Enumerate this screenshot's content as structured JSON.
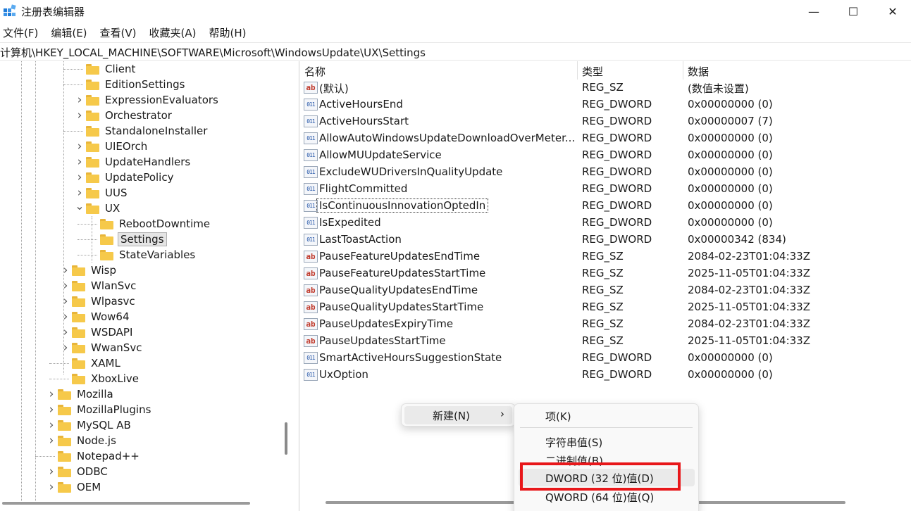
{
  "window": {
    "title": "注册表编辑器",
    "controls": {
      "minimize": "—",
      "maximize": "☐",
      "close": "✕"
    }
  },
  "menubar": [
    "文件(F)",
    "编辑(E)",
    "查看(V)",
    "收藏夹(A)",
    "帮助(H)"
  ],
  "address": "计算机\\HKEY_LOCAL_MACHINE\\SOFTWARE\\Microsoft\\WindowsUpdate\\UX\\Settings",
  "tree": [
    {
      "label": "Client",
      "expandable": false,
      "level": 2
    },
    {
      "label": "EditionSettings",
      "expandable": false,
      "level": 2
    },
    {
      "label": "ExpressionEvaluators",
      "expandable": true,
      "level": 2
    },
    {
      "label": "Orchestrator",
      "expandable": true,
      "level": 2
    },
    {
      "label": "StandaloneInstaller",
      "expandable": false,
      "level": 2
    },
    {
      "label": "UIEOrch",
      "expandable": true,
      "level": 2
    },
    {
      "label": "UpdateHandlers",
      "expandable": true,
      "level": 2
    },
    {
      "label": "UpdatePolicy",
      "expandable": true,
      "level": 2
    },
    {
      "label": "UUS",
      "expandable": true,
      "level": 2
    },
    {
      "label": "UX",
      "expandable": true,
      "expanded": true,
      "level": 2
    },
    {
      "label": "RebootDowntime",
      "expandable": false,
      "level": 3
    },
    {
      "label": "Settings",
      "expandable": false,
      "level": 3,
      "selected": true
    },
    {
      "label": "StateVariables",
      "expandable": false,
      "level": 3
    },
    {
      "label": "Wisp",
      "expandable": true,
      "level": 1
    },
    {
      "label": "WlanSvc",
      "expandable": true,
      "level": 1
    },
    {
      "label": "Wlpasvc",
      "expandable": true,
      "level": 1
    },
    {
      "label": "Wow64",
      "expandable": true,
      "level": 1
    },
    {
      "label": "WSDAPI",
      "expandable": true,
      "level": 1
    },
    {
      "label": "WwanSvc",
      "expandable": true,
      "level": 1
    },
    {
      "label": "XAML",
      "expandable": false,
      "level": 1
    },
    {
      "label": "XboxLive",
      "expandable": false,
      "level": 1
    },
    {
      "label": "Mozilla",
      "expandable": true,
      "level": 0
    },
    {
      "label": "MozillaPlugins",
      "expandable": true,
      "level": 0
    },
    {
      "label": "MySQL AB",
      "expandable": true,
      "level": 0
    },
    {
      "label": "Node.js",
      "expandable": true,
      "level": 0
    },
    {
      "label": "Notepad++",
      "expandable": false,
      "level": 0
    },
    {
      "label": "ODBC",
      "expandable": true,
      "level": 0
    },
    {
      "label": "OEM",
      "expandable": true,
      "level": 0
    }
  ],
  "list": {
    "headers": {
      "name": "名称",
      "type": "类型",
      "data": "数据"
    },
    "rows": [
      {
        "icon": "sz",
        "name": "(默认)",
        "type": "REG_SZ",
        "data": "(数值未设置)"
      },
      {
        "icon": "dw",
        "name": "ActiveHoursEnd",
        "type": "REG_DWORD",
        "data": "0x00000000 (0)"
      },
      {
        "icon": "dw",
        "name": "ActiveHoursStart",
        "type": "REG_DWORD",
        "data": "0x00000007 (7)"
      },
      {
        "icon": "dw",
        "name": "AllowAutoWindowsUpdateDownloadOverMeter...",
        "type": "REG_DWORD",
        "data": "0x00000000 (0)"
      },
      {
        "icon": "dw",
        "name": "AllowMUUpdateService",
        "type": "REG_DWORD",
        "data": "0x00000000 (0)"
      },
      {
        "icon": "dw",
        "name": "ExcludeWUDriversInQualityUpdate",
        "type": "REG_DWORD",
        "data": "0x00000000 (0)"
      },
      {
        "icon": "dw",
        "name": "FlightCommitted",
        "type": "REG_DWORD",
        "data": "0x00000000 (0)"
      },
      {
        "icon": "dw",
        "name": "IsContinuousInnovationOptedIn",
        "type": "REG_DWORD",
        "data": "0x00000000 (0)",
        "focused": true
      },
      {
        "icon": "dw",
        "name": "IsExpedited",
        "type": "REG_DWORD",
        "data": "0x00000000 (0)"
      },
      {
        "icon": "dw",
        "name": "LastToastAction",
        "type": "REG_DWORD",
        "data": "0x00000342 (834)"
      },
      {
        "icon": "sz",
        "name": "PauseFeatureUpdatesEndTime",
        "type": "REG_SZ",
        "data": "2084-02-23T01:04:33Z"
      },
      {
        "icon": "sz",
        "name": "PauseFeatureUpdatesStartTime",
        "type": "REG_SZ",
        "data": "2025-11-05T01:04:33Z"
      },
      {
        "icon": "sz",
        "name": "PauseQualityUpdatesEndTime",
        "type": "REG_SZ",
        "data": "2084-02-23T01:04:33Z"
      },
      {
        "icon": "sz",
        "name": "PauseQualityUpdatesStartTime",
        "type": "REG_SZ",
        "data": "2025-11-05T01:04:33Z"
      },
      {
        "icon": "sz",
        "name": "PauseUpdatesExpiryTime",
        "type": "REG_SZ",
        "data": "2084-02-23T01:04:33Z"
      },
      {
        "icon": "sz",
        "name": "PauseUpdatesStartTime",
        "type": "REG_SZ",
        "data": "2025-11-05T01:04:33Z"
      },
      {
        "icon": "dw",
        "name": "SmartActiveHoursSuggestionState",
        "type": "REG_DWORD",
        "data": "0x00000000 (0)"
      },
      {
        "icon": "dw",
        "name": "UxOption",
        "type": "REG_DWORD",
        "data": "0x00000000 (0)"
      }
    ]
  },
  "context_menu": {
    "new_label": "新建(N)",
    "arrow": "›",
    "submenu": [
      "项(K)",
      "字符串值(S)",
      "二进制值(B)",
      "DWORD (32 位)值(D)",
      "QWORD (64 位)值(Q)"
    ]
  },
  "icons": {
    "string_value": "ab",
    "dword_value": "011"
  },
  "colors": {
    "folder": "#f6c94a",
    "highlight": "#e8171a"
  }
}
